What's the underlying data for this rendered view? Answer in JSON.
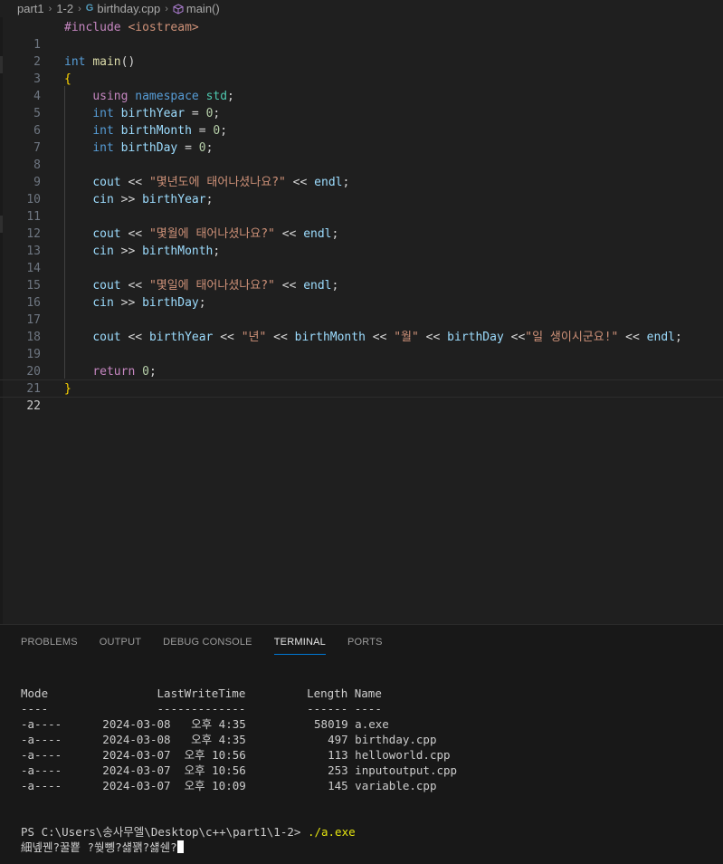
{
  "breadcrumb": {
    "items": [
      "part1",
      "1-2",
      "birthday.cpp",
      "main()"
    ],
    "separator": "›"
  },
  "editor": {
    "current_line": 22,
    "lines": [
      {
        "n": "1"
      },
      {
        "n": "2"
      },
      {
        "n": "3"
      },
      {
        "n": "4"
      },
      {
        "n": "5"
      },
      {
        "n": "6"
      },
      {
        "n": "7"
      },
      {
        "n": "8"
      },
      {
        "n": "9"
      },
      {
        "n": "10"
      },
      {
        "n": "11"
      },
      {
        "n": "12"
      },
      {
        "n": "13"
      },
      {
        "n": "14"
      },
      {
        "n": "15"
      },
      {
        "n": "16"
      },
      {
        "n": "17"
      },
      {
        "n": "18"
      },
      {
        "n": "19"
      },
      {
        "n": "20"
      },
      {
        "n": "21"
      },
      {
        "n": "22"
      }
    ],
    "code": {
      "l1_pre": "#include",
      "l1_inc": "<iostream>",
      "l3_kw": "int",
      "l3_fn": "main",
      "l3_rest": "()",
      "l4": "{",
      "l5_a": "using",
      "l5_b": "namespace",
      "l5_c": "std",
      "l5_d": ";",
      "int": "int",
      "l6_var": "birthYear",
      "l7_var": "birthMonth",
      "l8_var": "birthDay",
      "assign0": " = ",
      "zero": "0",
      "semi": ";",
      "cout": "cout",
      "cin": "cin",
      "out_op": " << ",
      "in_op": " >> ",
      "endl": "endl",
      "l10_str": "\"몇년도에 태어나셨나요?\"",
      "l13_str": "\"몇월에 태어나셨나요?\"",
      "l16_str": "\"몇일에 태어나셨나요?\"",
      "l19_s1": "\"년\"",
      "l19_s2": "\"월\"",
      "l19_s3": "\"일 생이시군요!\"",
      "l19_op_tight": " <<",
      "return": "return",
      "l21_zero": "0",
      "l22": "}"
    }
  },
  "panel": {
    "tabs": [
      "PROBLEMS",
      "OUTPUT",
      "DEBUG CONSOLE",
      "TERMINAL",
      "PORTS"
    ],
    "active_tab": "TERMINAL",
    "terminal": {
      "header": "Mode                LastWriteTime         Length Name",
      "underline": "----                -------------         ------ ----",
      "rows": [
        "-a----      2024-03-08   오후 4:35          58019 a.exe",
        "-a----      2024-03-08   오후 4:35            497 birthday.cpp",
        "-a----      2024-03-07  오후 10:56            113 helloworld.cpp",
        "-a----      2024-03-07  오후 10:56            253 inputoutput.cpp",
        "-a----      2024-03-07  오후 10:09            145 variable.cpp"
      ],
      "prompt": "PS C:\\Users\\송사무엘\\Desktop\\c++\\part1\\1-2> ",
      "command": "./a.exe",
      "output": "細녶꿴?꿀뿉 ?쒖뼹?섏꽭?섏쉔?"
    }
  },
  "colors": {
    "editor_bg": "#1f1f1f",
    "panel_bg": "#181818",
    "keyword": "#569cd6",
    "control": "#c586c0",
    "function": "#dcdcaa",
    "variable": "#9cdcfe",
    "string": "#ce9178",
    "number": "#b5cea8",
    "type": "#4ec9b0",
    "accent": "#0078d4"
  },
  "icons": {
    "file": "cpp-file-icon",
    "symbol": "method-cube-icon",
    "chevron": "chevron-right-icon"
  }
}
